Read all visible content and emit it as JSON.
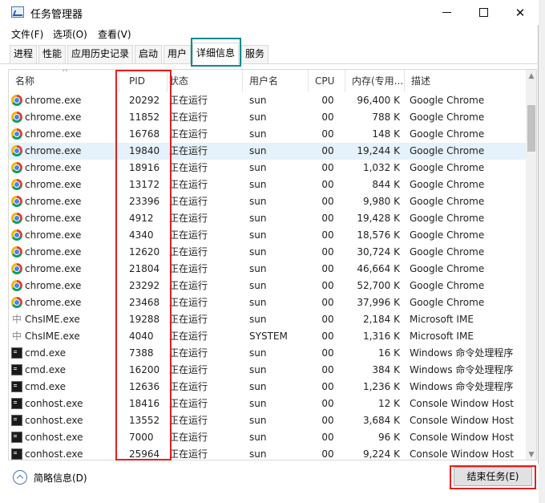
{
  "window": {
    "title": "任务管理器"
  },
  "menu": [
    "文件(F)",
    "选项(O)",
    "查看(V)"
  ],
  "tabs": [
    {
      "label": "进程",
      "active": false
    },
    {
      "label": "性能",
      "active": false
    },
    {
      "label": "应用历史记录",
      "active": false
    },
    {
      "label": "启动",
      "active": false
    },
    {
      "label": "用户",
      "active": false
    },
    {
      "label": "详细信息",
      "active": true
    },
    {
      "label": "服务",
      "active": false
    }
  ],
  "columns": {
    "name": "名称",
    "pid": "PID",
    "status": "状态",
    "user": "用户名",
    "cpu": "CPU",
    "memory": "内存(专用...",
    "description": "描述"
  },
  "rows": [
    {
      "icon": "chrome-icon",
      "name": "chrome.exe",
      "pid": "20292",
      "status": "正在运行",
      "user": "sun",
      "cpu": "00",
      "memory": "96,400 K",
      "description": "Google Chrome",
      "selected": false
    },
    {
      "icon": "chrome-icon",
      "name": "chrome.exe",
      "pid": "11852",
      "status": "正在运行",
      "user": "sun",
      "cpu": "00",
      "memory": "788 K",
      "description": "Google Chrome",
      "selected": false
    },
    {
      "icon": "chrome-icon",
      "name": "chrome.exe",
      "pid": "16768",
      "status": "正在运行",
      "user": "sun",
      "cpu": "00",
      "memory": "148 K",
      "description": "Google Chrome",
      "selected": false
    },
    {
      "icon": "chrome-icon",
      "name": "chrome.exe",
      "pid": "19840",
      "status": "正在运行",
      "user": "sun",
      "cpu": "00",
      "memory": "19,244 K",
      "description": "Google Chrome",
      "selected": true
    },
    {
      "icon": "chrome-icon",
      "name": "chrome.exe",
      "pid": "18916",
      "status": "正在运行",
      "user": "sun",
      "cpu": "00",
      "memory": "1,032 K",
      "description": "Google Chrome",
      "selected": false
    },
    {
      "icon": "chrome-icon",
      "name": "chrome.exe",
      "pid": "13172",
      "status": "正在运行",
      "user": "sun",
      "cpu": "00",
      "memory": "844 K",
      "description": "Google Chrome",
      "selected": false
    },
    {
      "icon": "chrome-icon",
      "name": "chrome.exe",
      "pid": "23396",
      "status": "正在运行",
      "user": "sun",
      "cpu": "00",
      "memory": "9,980 K",
      "description": "Google Chrome",
      "selected": false
    },
    {
      "icon": "chrome-icon",
      "name": "chrome.exe",
      "pid": "4912",
      "status": "正在运行",
      "user": "sun",
      "cpu": "00",
      "memory": "19,428 K",
      "description": "Google Chrome",
      "selected": false
    },
    {
      "icon": "chrome-icon",
      "name": "chrome.exe",
      "pid": "4340",
      "status": "正在运行",
      "user": "sun",
      "cpu": "00",
      "memory": "18,576 K",
      "description": "Google Chrome",
      "selected": false
    },
    {
      "icon": "chrome-icon",
      "name": "chrome.exe",
      "pid": "12620",
      "status": "正在运行",
      "user": "sun",
      "cpu": "00",
      "memory": "30,724 K",
      "description": "Google Chrome",
      "selected": false
    },
    {
      "icon": "chrome-icon",
      "name": "chrome.exe",
      "pid": "21804",
      "status": "正在运行",
      "user": "sun",
      "cpu": "00",
      "memory": "46,664 K",
      "description": "Google Chrome",
      "selected": false
    },
    {
      "icon": "chrome-icon",
      "name": "chrome.exe",
      "pid": "23292",
      "status": "正在运行",
      "user": "sun",
      "cpu": "00",
      "memory": "52,700 K",
      "description": "Google Chrome",
      "selected": false
    },
    {
      "icon": "chrome-icon",
      "name": "chrome.exe",
      "pid": "23468",
      "status": "正在运行",
      "user": "sun",
      "cpu": "00",
      "memory": "37,996 K",
      "description": "Google Chrome",
      "selected": false
    },
    {
      "icon": "ime-icon",
      "name": "ChsIME.exe",
      "pid": "19288",
      "status": "正在运行",
      "user": "sun",
      "cpu": "00",
      "memory": "2,184 K",
      "description": "Microsoft IME",
      "selected": false
    },
    {
      "icon": "ime-icon",
      "name": "ChsIME.exe",
      "pid": "4040",
      "status": "正在运行",
      "user": "SYSTEM",
      "cpu": "00",
      "memory": "1,316 K",
      "description": "Microsoft IME",
      "selected": false
    },
    {
      "icon": "cmd-icon",
      "name": "cmd.exe",
      "pid": "7388",
      "status": "正在运行",
      "user": "sun",
      "cpu": "00",
      "memory": "16 K",
      "description": "Windows 命令处理程序",
      "selected": false
    },
    {
      "icon": "cmd-icon",
      "name": "cmd.exe",
      "pid": "16200",
      "status": "正在运行",
      "user": "sun",
      "cpu": "00",
      "memory": "384 K",
      "description": "Windows 命令处理程序",
      "selected": false
    },
    {
      "icon": "cmd-icon",
      "name": "cmd.exe",
      "pid": "12636",
      "status": "正在运行",
      "user": "sun",
      "cpu": "00",
      "memory": "1,236 K",
      "description": "Windows 命令处理程序",
      "selected": false
    },
    {
      "icon": "cmd-icon",
      "name": "conhost.exe",
      "pid": "18416",
      "status": "正在运行",
      "user": "sun",
      "cpu": "00",
      "memory": "12 K",
      "description": "Console Window Host",
      "selected": false
    },
    {
      "icon": "cmd-icon",
      "name": "conhost.exe",
      "pid": "13552",
      "status": "正在运行",
      "user": "sun",
      "cpu": "00",
      "memory": "3,684 K",
      "description": "Console Window Host",
      "selected": false
    },
    {
      "icon": "cmd-icon",
      "name": "conhost.exe",
      "pid": "7000",
      "status": "正在运行",
      "user": "sun",
      "cpu": "00",
      "memory": "96 K",
      "description": "Console Window Host",
      "selected": false
    },
    {
      "icon": "cmd-icon",
      "name": "conhost.exe",
      "pid": "25964",
      "status": "正在运行",
      "user": "sun",
      "cpu": "00",
      "memory": "9,224 K",
      "description": "Console Window Host",
      "selected": false
    }
  ],
  "footer": {
    "fewer_details": "简略信息(D)",
    "end_task": "结束任务(E)"
  },
  "colors": {
    "selected_row": "#e5f1fb",
    "tab_highlight": "#0e8a8a",
    "annotation_red": "#e02020"
  }
}
